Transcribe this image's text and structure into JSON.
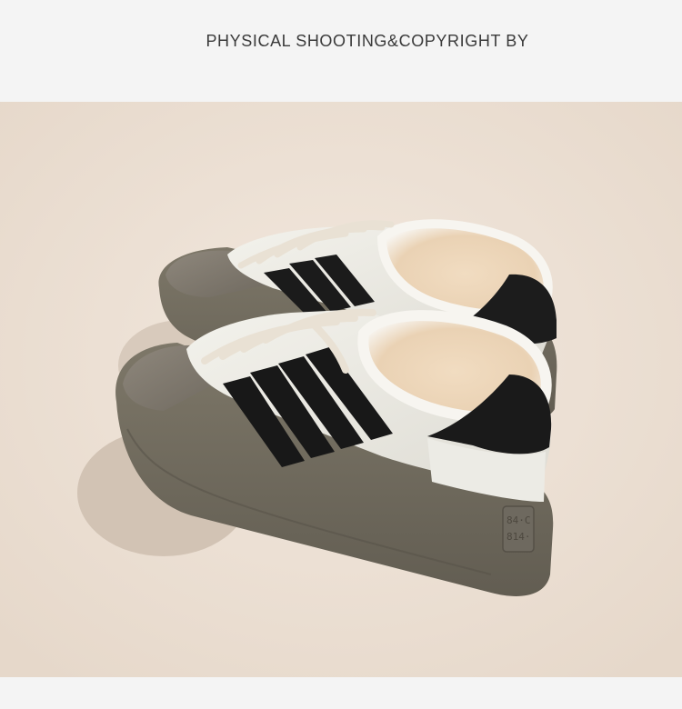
{
  "header": {
    "title": "PHYSICAL SHOOTING&COPYRIGHT BY"
  },
  "photo": {
    "background_color": "#ece0d4",
    "heel_emboss_text_line1": "84·C",
    "heel_emboss_text_line2": "814·"
  }
}
